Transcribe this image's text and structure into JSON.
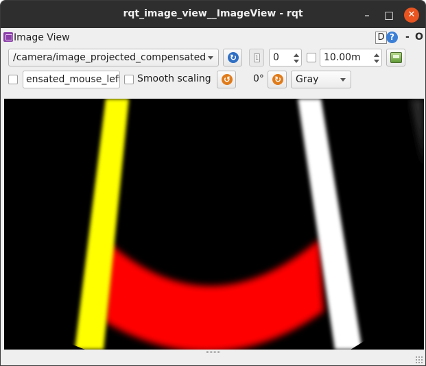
{
  "window": {
    "title": "rqt_image_view__ImageView - rqt",
    "minimize_glyph": "–",
    "maximize_glyph": "□",
    "close_glyph": "✕"
  },
  "plugin": {
    "title": "Image View",
    "icon": "image-view-plugin-icon",
    "d_label": "D",
    "help_label": "?",
    "dash_label": "-",
    "o_label": "O"
  },
  "toolbar": {
    "topic": "/camera/image_projected_compensated",
    "refresh_icon": "refresh-icon",
    "number_value": "0",
    "timeout_value": "10.00m",
    "save_icon": "save-image-icon"
  },
  "options": {
    "mouse_topic": "ensated_mouse_left",
    "smooth_scaling_label": "Smooth scaling",
    "rotation_value": "0°",
    "rotate_left_icon": "rotate-left-icon",
    "rotate_right_icon": "rotate-right-icon",
    "color_scheme": "Gray"
  },
  "colors": {
    "titlebar": "#2e2e2e",
    "close_button": "#e95420",
    "lane_left": "#ffff00",
    "lane_right": "#ffffff",
    "band": "#ff0000"
  }
}
